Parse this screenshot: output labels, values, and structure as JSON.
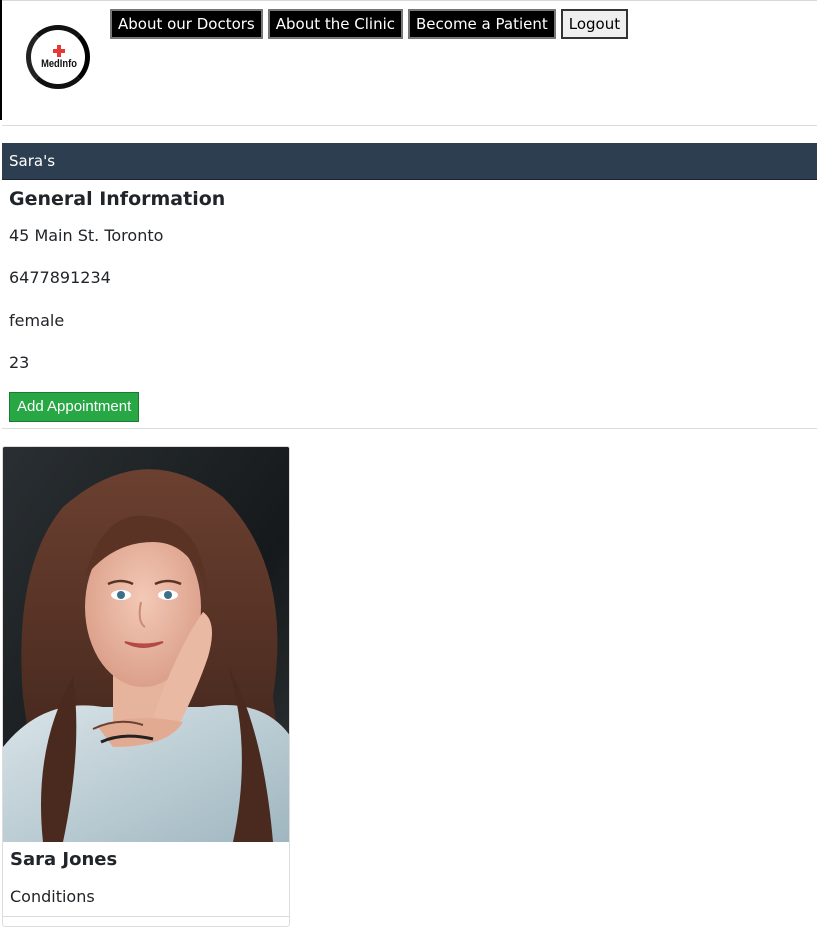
{
  "logo": {
    "text": "MedInfo"
  },
  "nav": {
    "items": [
      {
        "label": "About our Doctors"
      },
      {
        "label": "About the Clinic"
      },
      {
        "label": "Become a Patient"
      },
      {
        "label": "Logout"
      }
    ]
  },
  "patient": {
    "header": "Sara's",
    "section_title": "General Information",
    "address": "45 Main St. Toronto",
    "phone": "6477891234",
    "gender": "female",
    "age": "23",
    "add_button": "Add Appointment"
  },
  "profile": {
    "name": "Sara Jones",
    "conditions_label": "Conditions"
  },
  "colors": {
    "header_bg": "#2c3e50",
    "success": "#28a745",
    "nav_bg": "#000000",
    "logo_cross": "#e53935"
  }
}
